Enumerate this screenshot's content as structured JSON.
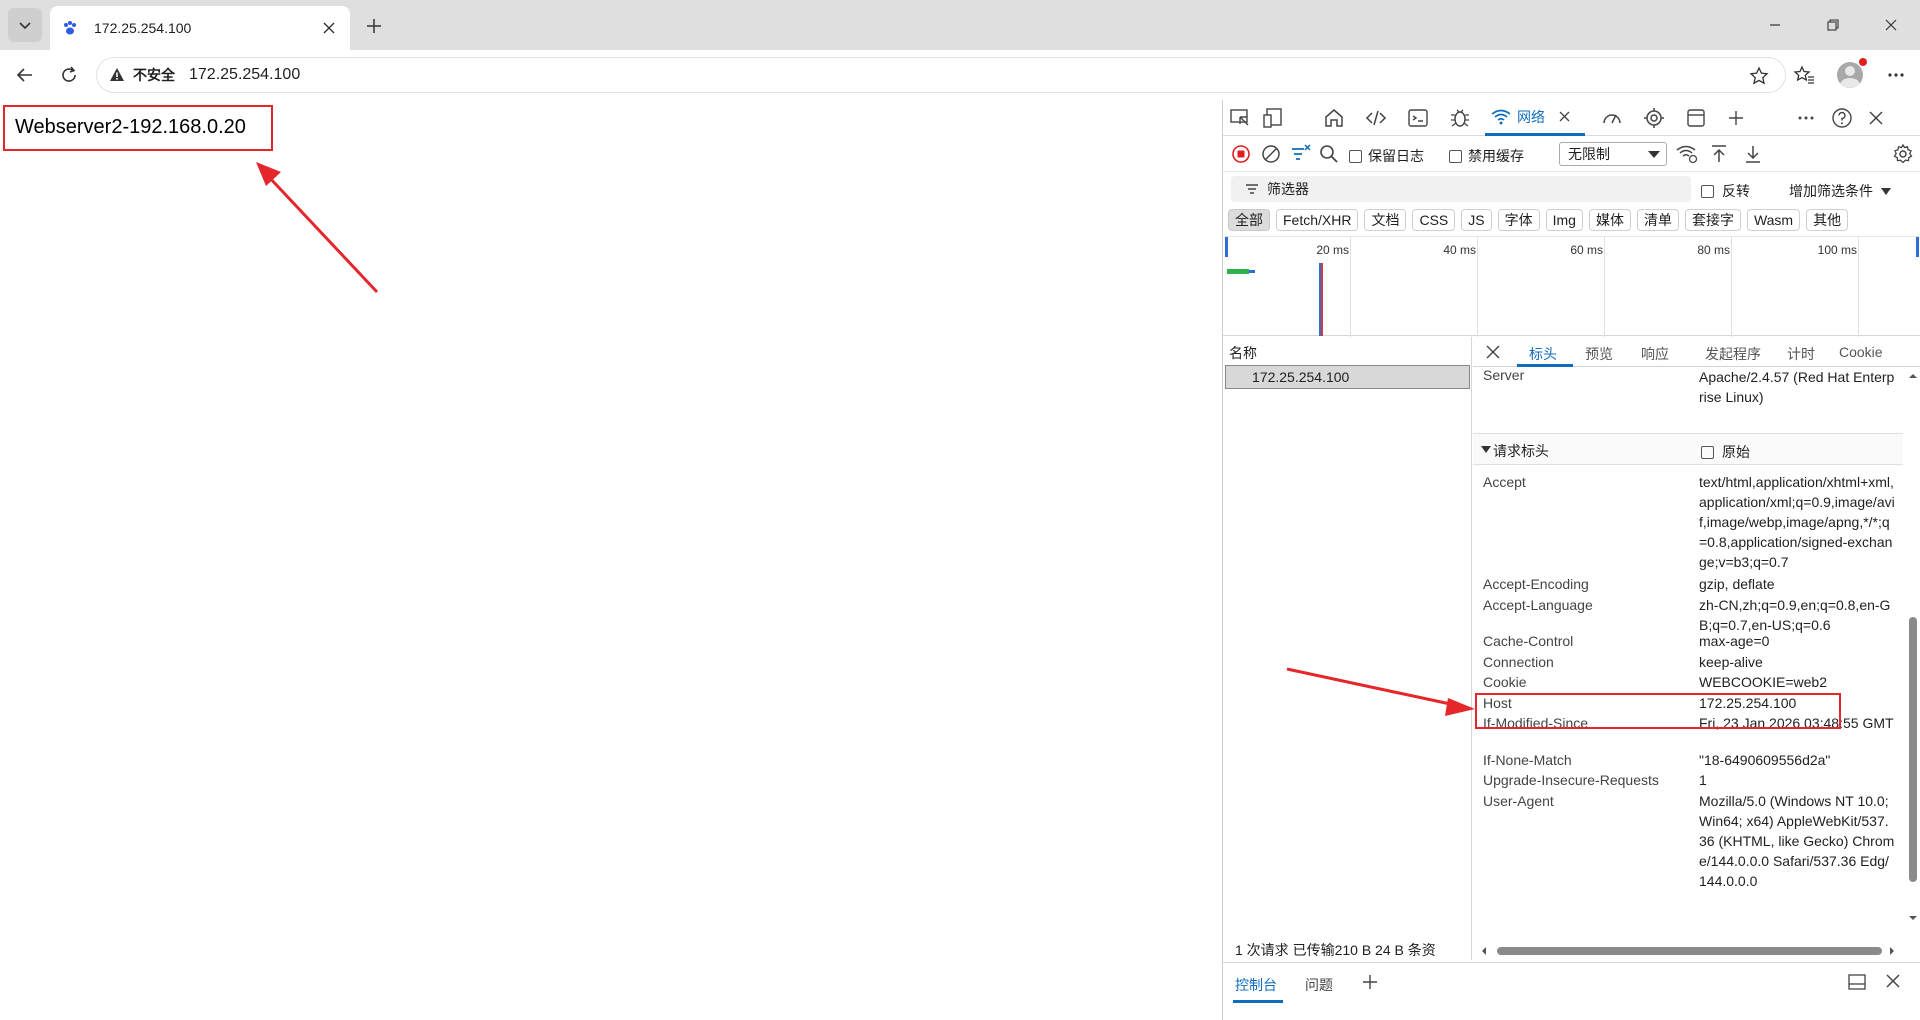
{
  "browser": {
    "tab": {
      "title": "172.25.254.100"
    },
    "address": {
      "security_label": "不安全",
      "url": "172.25.254.100"
    }
  },
  "page": {
    "body_text": "Webserver2-192.168.0.20"
  },
  "devtools": {
    "active_tab_label": "网络",
    "toolbar": {
      "preserve_log": "保留日志",
      "disable_cache": "禁用缓存",
      "throttle": "无限制"
    },
    "filter": {
      "placeholder": "筛选器",
      "invert": "反转",
      "more_filters": "增加筛选条件"
    },
    "type_filters": [
      "全部",
      "Fetch/XHR",
      "文档",
      "CSS",
      "JS",
      "字体",
      "Img",
      "媒体",
      "清单",
      "套接字",
      "Wasm",
      "其他"
    ],
    "timeline_labels": [
      "20 ms",
      "40 ms",
      "60 ms",
      "80 ms",
      "100 ms"
    ],
    "name_column": {
      "header": "名称",
      "rows": [
        "172.25.254.100"
      ]
    },
    "status_bar": "1 次请求   已传输210 B   24 B 条资",
    "detail_tabs": [
      "标头",
      "预览",
      "响应",
      "发起程序",
      "计时",
      "Cookie"
    ],
    "response_headers_tail": {
      "name": "Server",
      "value": "Apache/2.4.57 (Red Hat Enterprise Linux)"
    },
    "request_section": {
      "title": "请求标头",
      "raw": "原始"
    },
    "request_headers": [
      {
        "name": "Accept",
        "value": "text/html,application/xhtml+xml,application/xml;q=0.9,image/avif,image/webp,image/apng,*/*;q=0.8,application/signed-exchange;v=b3;q=0.7"
      },
      {
        "name": "Accept-Encoding",
        "value": "gzip, deflate"
      },
      {
        "name": "Accept-Language",
        "value": "zh-CN,zh;q=0.9,en;q=0.8,en-GB;q=0.7,en-US;q=0.6"
      },
      {
        "name": "Cache-Control",
        "value": "max-age=0"
      },
      {
        "name": "Connection",
        "value": "keep-alive"
      },
      {
        "name": "Cookie",
        "value": "WEBCOOKIE=web2"
      },
      {
        "name": "Host",
        "value": "172.25.254.100"
      },
      {
        "name": "If-Modified-Since",
        "value": "Fri, 23 Jan 2026 03:48:55 GMT"
      },
      {
        "name": "If-None-Match",
        "value": "\"18-6490609556d2a\""
      },
      {
        "name": "Upgrade-Insecure-Requests",
        "value": "1"
      },
      {
        "name": "User-Agent",
        "value": "Mozilla/5.0 (Windows NT 10.0; Win64; x64) AppleWebKit/537.36 (KHTML, like Gecko) Chrome/144.0.0.0 Safari/537.36 Edg/144.0.0.0"
      }
    ],
    "drawer": {
      "tabs": [
        "控制台",
        "问题"
      ]
    }
  },
  "colors": {
    "accent": "#0f6cbd",
    "annotation_red": "#e5262b",
    "record_red": "#e02020"
  }
}
